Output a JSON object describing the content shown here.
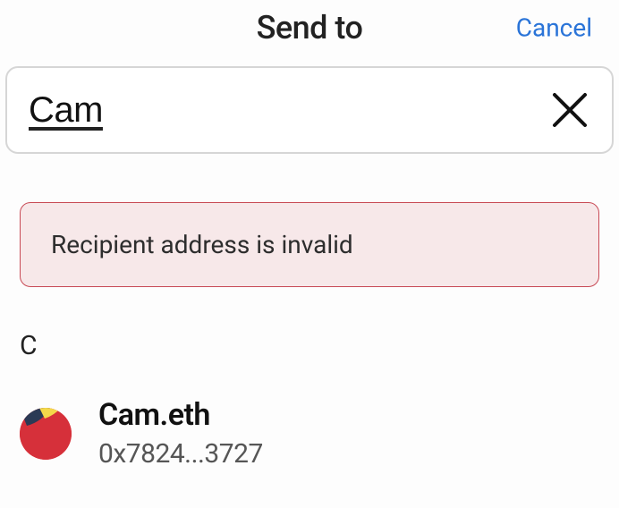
{
  "header": {
    "title": "Send to",
    "cancel_label": "Cancel"
  },
  "search": {
    "value": "Cam",
    "placeholder": ""
  },
  "error": {
    "message": "Recipient address is invalid"
  },
  "section": {
    "letter": "C"
  },
  "contacts": [
    {
      "name": "Cam.eth",
      "address": "0x7824...3727"
    }
  ]
}
